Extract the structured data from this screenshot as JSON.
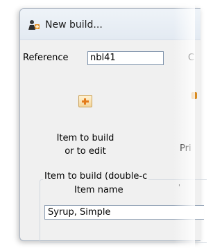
{
  "window": {
    "title": "New build..."
  },
  "reference": {
    "label": "Reference",
    "value": "nbl41",
    "next_label_clipped": "C"
  },
  "add_item": {
    "icon": "plus-icon",
    "label": "Item to build or to edit",
    "label_line1": "Item to build",
    "label_line2": "or to edit"
  },
  "clipped": {
    "label_fragment": "Pri"
  },
  "item_group": {
    "legend": "Item to build (double-c",
    "column_header": "Item name",
    "column_tick": "'",
    "rows": [
      {
        "item_name": "Syrup, Simple"
      }
    ]
  },
  "colors": {
    "window_bg": "#f0f0f0",
    "titlebar_bg": "#e3eaf2",
    "input_border": "#7a8fa8",
    "accent_orange": "#e37b1a"
  }
}
